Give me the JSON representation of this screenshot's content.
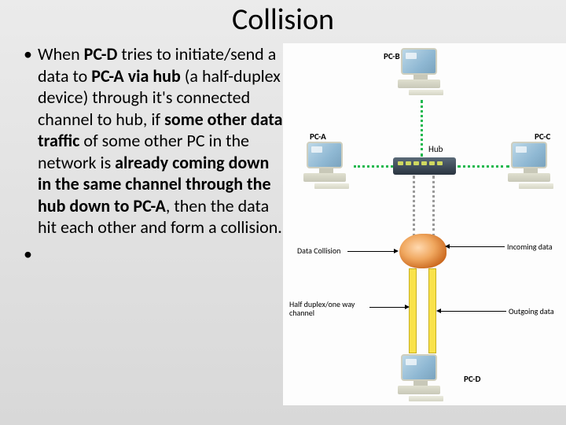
{
  "title": "Collision",
  "bullet": {
    "segments": [
      {
        "t": "When ",
        "b": false
      },
      {
        "t": "PC-D ",
        "b": true
      },
      {
        "t": "tries to initiate/send a data to ",
        "b": false
      },
      {
        "t": "PC-A via hub ",
        "b": true
      },
      {
        "t": "(a half-duplex device) through it's connected channel to hub, if ",
        "b": false
      },
      {
        "t": "some other data traffic ",
        "b": true
      },
      {
        "t": "of some other PC in the network is ",
        "b": false
      },
      {
        "t": "already coming down in the same channel through the hub down to PC-A",
        "b": true
      },
      {
        "t": ", then the data hit each other and form a collision.",
        "b": false
      }
    ]
  },
  "diagram": {
    "pcA": "PC-A",
    "pcB": "PC-B",
    "pcC": "PC-C",
    "pcD": "PC-D",
    "hub": "Hub",
    "dataCollision": "Data Collision",
    "incoming": "Incoming data",
    "outgoing": "Outgoing data",
    "halfDuplex": "Half duplex/one way channel"
  }
}
